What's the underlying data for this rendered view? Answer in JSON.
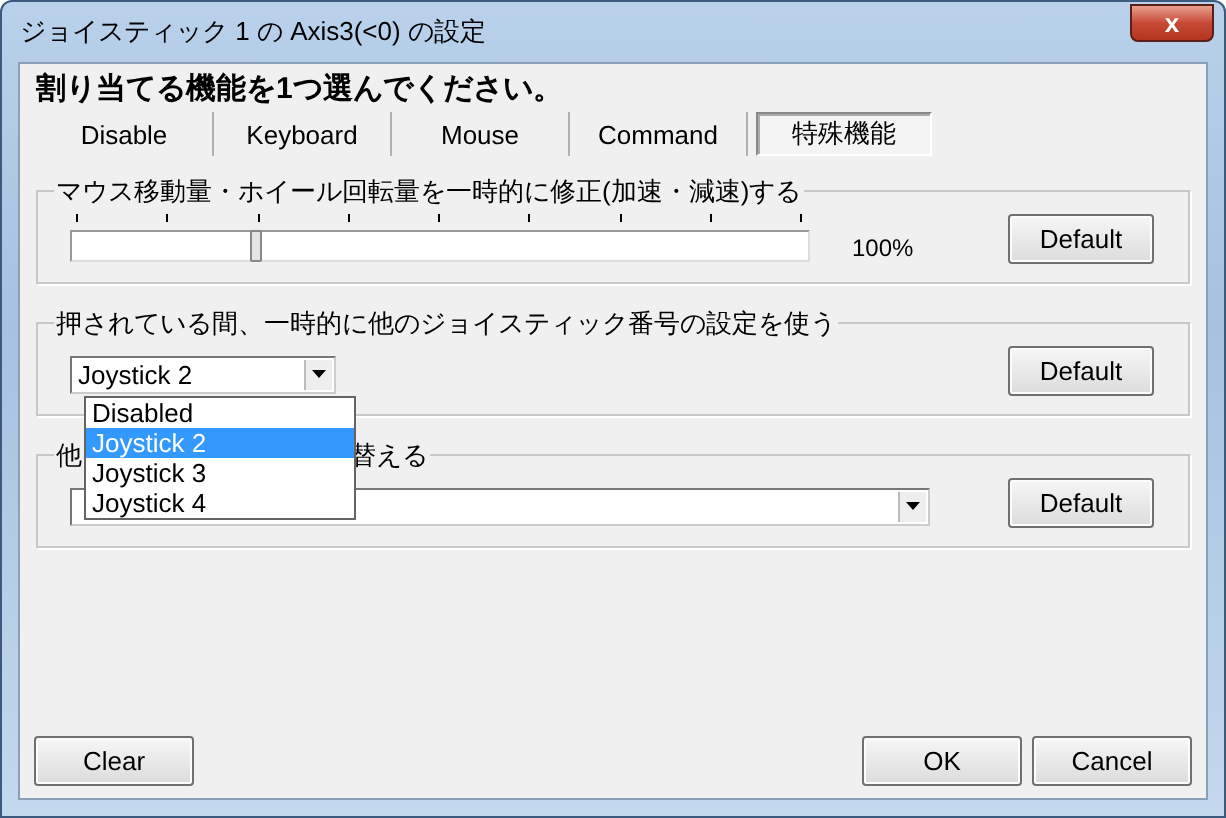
{
  "window": {
    "title": "ジョイスティック 1 の Axis3(<0) の設定",
    "close": "x"
  },
  "heading": "割り当てる機能を1つ選んでください。",
  "tabs": [
    {
      "label": "Disable",
      "selected": false
    },
    {
      "label": "Keyboard",
      "selected": false
    },
    {
      "label": "Mouse",
      "selected": false
    },
    {
      "label": "Command",
      "selected": false
    },
    {
      "label": "特殊機能",
      "selected": true
    }
  ],
  "groups": [
    {
      "kind": "slider",
      "legend": [
        "マウス移動量・ホイール回転量を一時的に修正(加速・減速)する"
      ],
      "level": 0.25,
      "reading": "100%",
      "button": "Default"
    },
    {
      "kind": "combo",
      "legend": [
        "押されている間、一時的に他のジョイスティック番号の設定を使う"
      ],
      "value": "Joystick 2",
      "wide": false,
      "button": "Default"
    },
    {
      "kind": "combo",
      "legend": [
        "他",
        "替える"
      ],
      "wide": true,
      "button": "Default"
    }
  ],
  "dropdown": {
    "items": [
      {
        "label": "Disabled",
        "selected": false
      },
      {
        "label": "Joystick 2",
        "selected": true
      },
      {
        "label": "Joystick 3",
        "selected": false
      },
      {
        "label": "Joystick 4",
        "selected": false
      }
    ]
  },
  "buttons": {
    "left": [
      "Clear"
    ],
    "right": [
      "OK",
      "Cancel"
    ]
  }
}
